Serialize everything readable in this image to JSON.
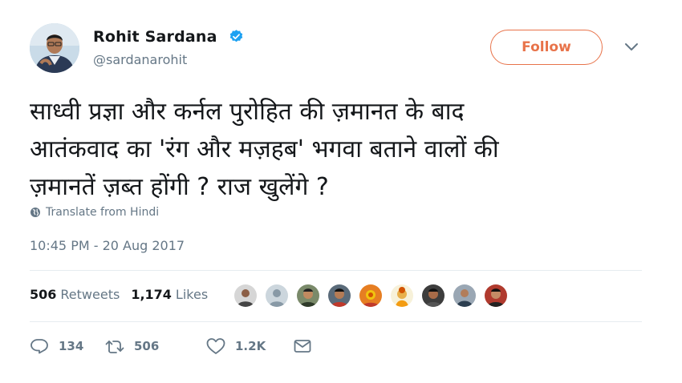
{
  "author": {
    "name": "Rohit Sardana",
    "handle": "@sardanarohit"
  },
  "follow_label": "Follow",
  "tweet": {
    "text_lines": [
      "साध्वी प्रज्ञा और कर्नल पुरोहित की ज़मानत के बाद",
      "आतंकवाद का 'रंग और मज़हब' भगवा बताने वालों की",
      "ज़मानतें ज़ब्त होंगी ? राज खुलेंगे ?"
    ],
    "translate_label": "Translate from Hindi",
    "timestamp": "10:45 PM - 20 Aug 2017"
  },
  "stats": {
    "retweets_count": "506",
    "retweets_label": "Retweets",
    "likes_count": "1,174",
    "likes_label": "Likes"
  },
  "actions": {
    "reply_count": "134",
    "retweet_count": "506",
    "like_count": "1.2K"
  },
  "colors": {
    "follow_accent": "#e8734a",
    "verified_blue": "#1da1f2",
    "muted_text": "#657786"
  },
  "icons": [
    "verified-badge-icon",
    "chevron-down-icon",
    "globe-icon",
    "reply-icon",
    "retweet-icon",
    "heart-icon",
    "envelope-icon"
  ]
}
